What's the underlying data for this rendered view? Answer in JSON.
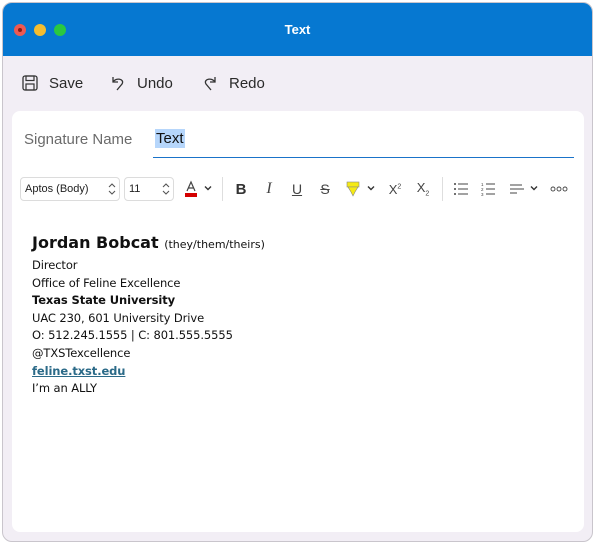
{
  "window": {
    "title": "Text"
  },
  "toolbar": {
    "save_label": "Save",
    "undo_label": "Undo",
    "redo_label": "Redo"
  },
  "signature_name": {
    "label": "Signature Name",
    "value": "Text"
  },
  "format_bar": {
    "font_family": "Aptos (Body)",
    "font_size": "11",
    "font_color": "#d40000",
    "highlight_color": "#f5ea14",
    "icons": [
      "font-color-icon",
      "bold-icon",
      "italic-icon",
      "underline-icon",
      "strikethrough-icon",
      "highlight-icon",
      "superscript-icon",
      "subscript-icon",
      "bullet-list-icon",
      "numbered-list-icon",
      "align-icon",
      "more-icon"
    ]
  },
  "signature": {
    "name": "Jordan Bobcat",
    "pronouns": "(they/them/theirs)",
    "title": "Director",
    "office": "Office of Feline Excellence",
    "university": "Texas State University",
    "address": "UAC 230, 601 University Drive",
    "phones": "O: 512.245.1555 | C: 801.555.5555",
    "handle": "@TXSTexcellence",
    "website": "feline.txst.edu",
    "tagline": "I’m an ALLY"
  }
}
